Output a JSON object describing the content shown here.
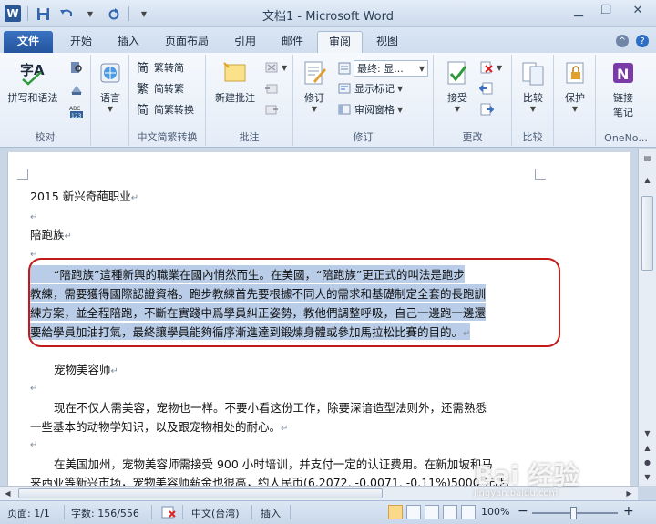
{
  "window": {
    "title": "文档1 - Microsoft Word"
  },
  "tabs": [
    {
      "label": "文件"
    },
    {
      "label": "开始"
    },
    {
      "label": "插入"
    },
    {
      "label": "页面布局"
    },
    {
      "label": "引用"
    },
    {
      "label": "邮件"
    },
    {
      "label": "审阅"
    },
    {
      "label": "视图"
    }
  ],
  "ribbon": {
    "proofing": {
      "label": "校对",
      "spelling": "拼写和语法"
    },
    "language": {
      "label": "语言"
    },
    "chinese": {
      "label": "中文简繁转换",
      "to_trad": "繁转简",
      "to_simp": "简转繁",
      "convert": "简繁转换"
    },
    "comments": {
      "label": "批注",
      "new_comment": "新建批注"
    },
    "tracking": {
      "label": "修订",
      "track": "修订",
      "display": "最终: 显...",
      "show_markup": "显示标记",
      "pane": "审阅窗格"
    },
    "changes": {
      "label": "更改",
      "accept": "接受"
    },
    "compare": {
      "label": "比较",
      "compare": "比较"
    },
    "protect": {
      "protect": "保护"
    },
    "onenote": {
      "label": "OneNo...",
      "linked": "链接",
      "notes": "笔记"
    }
  },
  "document": {
    "lines": [
      "2015 新兴奇葩职业",
      "陪跑族",
      "“陪跑族”這種新興的職業在國內悄然而生。在美國，“陪跑族”更正式的叫法是跑步",
      "教練，需要獲得國際認證資格。跑步教練首先要根據不同人的需求和基礎制定全套的長跑訓",
      "練方案，並全程陪跑，不斷在實踐中爲學員糾正姿勢，教他們調整呼吸，自己一邊跑一邊還",
      "要給學員加油打氣，最終讓學員能夠循序漸進達到鍛煉身體或參加馬拉松比賽的目的。",
      "宠物美容师",
      "现在不仅人需美容，宠物也一样。不要小看这份工作，除要深谙造型法则外，还需熟悉",
      "一些基本的动物学知识，以及跟宠物相处的耐心。",
      "在美国加州，宠物美容师需接受 900 小时培训，并支付一定的认证费用。在新加坡和马",
      "来西亚等新兴市场，宠物美容师薪金也很高，约人民币(6.2072, -0.0071, -0.11%)5000 元/月"
    ],
    "pilcrow": "↵"
  },
  "status": {
    "page": "页面: 1/1",
    "words": "字数: 156/556",
    "language": "中文(台湾)",
    "mode": "插入",
    "zoom": "100%",
    "minus": "−",
    "plus": "+"
  },
  "watermark": {
    "brand": "Bai 经验",
    "sub": "jingyan.baidu.com"
  }
}
